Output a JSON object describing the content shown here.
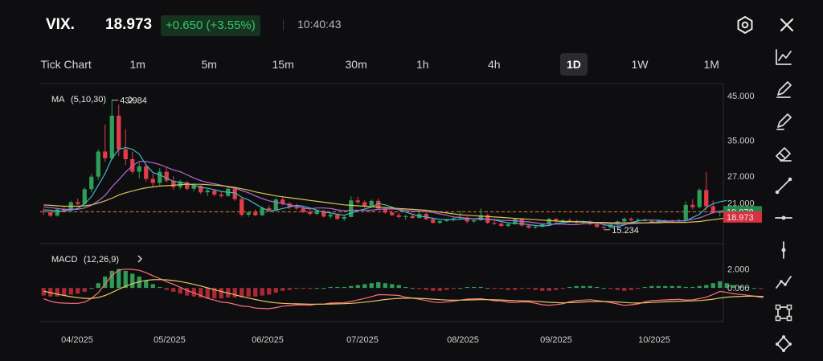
{
  "header": {
    "symbol": "VIX.",
    "price": "18.973",
    "change": "+0.650 (+3.55%)",
    "time": "10:40:43"
  },
  "timeframes": [
    "Tick Chart",
    "1m",
    "5m",
    "15m",
    "30m",
    "1h",
    "4h",
    "1D",
    "1W",
    "1M"
  ],
  "active_timeframe": "1D",
  "toolbar_icons": [
    "chart-type-icon",
    "pencil-icon",
    "brush-icon",
    "eraser-icon",
    "trend-line-icon",
    "horizontal-line-icon",
    "vertical-line-icon",
    "polyline-icon",
    "rectangle-icon",
    "pattern-icon"
  ],
  "colors": {
    "up": "#2f9c58",
    "down": "#e23c49",
    "ma5": "#3fb7c4",
    "ma10": "#b46bd6",
    "ma30": "#d8c553",
    "dif": "#ff6f7e",
    "dea": "#e6c560",
    "background": "#0e0e10"
  },
  "chart_data": [
    {
      "type": "candlestick",
      "title": "",
      "indicator_label": "MA",
      "indicator_params": "(5,10,30)",
      "x_labels": [
        "04/2025",
        "05/2025",
        "06/2025",
        "07/2025",
        "08/2025",
        "09/2025",
        "10/2025"
      ],
      "y_ticks": [
        "45.000",
        "35.000",
        "27.000",
        "21.000"
      ],
      "ylim": [
        12.5,
        45.5
      ],
      "max_annotation": "43.984",
      "min_annotation": "15.234",
      "max_value": 43.984,
      "min_value": 15.234,
      "prev_close_tag": "19.078",
      "last_price_tag": "18.973",
      "prev_close": 19.078,
      "last_price": 18.973,
      "ohlc": [
        [
          19.2,
          19.8,
          18.4,
          19.0
        ],
        [
          19.0,
          19.5,
          17.9,
          18.2
        ],
        [
          18.2,
          19.9,
          18.0,
          19.6
        ],
        [
          19.6,
          20.4,
          19.0,
          19.3
        ],
        [
          19.3,
          21.5,
          19.1,
          21.2
        ],
        [
          21.2,
          22.0,
          20.5,
          20.8
        ],
        [
          20.8,
          24.5,
          20.5,
          24.1
        ],
        [
          24.1,
          27.5,
          23.4,
          26.9
        ],
        [
          26.9,
          33.0,
          26.2,
          32.5
        ],
        [
          32.5,
          38.5,
          30.2,
          31.0
        ],
        [
          31.0,
          43.984,
          30.6,
          40.5
        ],
        [
          40.5,
          43.0,
          31.5,
          33.0
        ],
        [
          33.0,
          37.5,
          29.5,
          30.8
        ],
        [
          30.8,
          32.5,
          27.5,
          28.0
        ],
        [
          28.0,
          30.0,
          26.5,
          29.2
        ],
        [
          29.2,
          29.5,
          25.8,
          26.4
        ],
        [
          26.4,
          27.5,
          24.5,
          25.5
        ],
        [
          25.5,
          28.8,
          25.0,
          28.0
        ],
        [
          28.0,
          29.0,
          25.5,
          26.0
        ],
        [
          26.0,
          27.0,
          24.0,
          24.6
        ],
        [
          24.6,
          26.2,
          24.1,
          25.6
        ],
        [
          25.6,
          25.9,
          23.8,
          24.2
        ],
        [
          24.2,
          25.4,
          23.6,
          24.9
        ],
        [
          24.9,
          25.0,
          23.0,
          23.4
        ],
        [
          23.4,
          24.2,
          22.6,
          23.8
        ],
        [
          23.8,
          24.0,
          22.5,
          22.9
        ],
        [
          22.9,
          23.5,
          22.2,
          22.6
        ],
        [
          22.6,
          24.6,
          22.4,
          24.2
        ],
        [
          24.2,
          24.5,
          21.5,
          21.9
        ],
        [
          21.9,
          22.2,
          18.0,
          18.4
        ],
        [
          18.4,
          19.2,
          17.9,
          18.9
        ],
        [
          18.9,
          19.6,
          18.1,
          18.3
        ],
        [
          18.3,
          20.2,
          18.1,
          19.9
        ],
        [
          19.9,
          20.5,
          19.3,
          19.5
        ],
        [
          19.5,
          22.2,
          19.4,
          21.8
        ],
        [
          21.8,
          22.5,
          20.5,
          20.9
        ],
        [
          20.9,
          21.2,
          19.6,
          20.1
        ],
        [
          20.1,
          20.8,
          19.5,
          19.8
        ],
        [
          19.8,
          20.2,
          18.8,
          19.0
        ],
        [
          19.0,
          19.5,
          18.2,
          18.6
        ],
        [
          18.6,
          19.6,
          18.3,
          19.3
        ],
        [
          19.3,
          19.5,
          17.8,
          18.0
        ],
        [
          18.0,
          18.7,
          17.5,
          18.4
        ],
        [
          18.4,
          18.6,
          17.2,
          17.5
        ],
        [
          17.5,
          18.2,
          17.0,
          17.9
        ],
        [
          17.9,
          22.5,
          17.8,
          21.6
        ],
        [
          21.6,
          22.4,
          20.8,
          21.2
        ],
        [
          21.2,
          21.6,
          20.0,
          20.4
        ],
        [
          20.4,
          21.8,
          20.1,
          21.5
        ],
        [
          21.5,
          22.0,
          19.5,
          19.8
        ],
        [
          19.8,
          20.2,
          18.6,
          18.9
        ],
        [
          18.9,
          19.4,
          18.1,
          18.3
        ],
        [
          18.3,
          18.8,
          17.6,
          17.9
        ],
        [
          17.9,
          18.4,
          17.3,
          18.1
        ],
        [
          18.1,
          18.6,
          17.5,
          17.7
        ],
        [
          17.7,
          18.9,
          17.5,
          18.6
        ],
        [
          18.6,
          18.9,
          17.2,
          17.4
        ],
        [
          17.4,
          17.8,
          16.4,
          16.6
        ],
        [
          16.6,
          17.2,
          16.3,
          17.0
        ],
        [
          17.0,
          17.5,
          16.8,
          17.3
        ],
        [
          17.3,
          17.8,
          16.9,
          17.6
        ],
        [
          17.6,
          19.3,
          17.5,
          17.8
        ],
        [
          17.8,
          18.0,
          16.5,
          16.9
        ],
        [
          16.9,
          17.4,
          16.6,
          17.2
        ],
        [
          17.2,
          19.8,
          17.0,
          18.3
        ],
        [
          18.3,
          18.6,
          16.3,
          16.6
        ],
        [
          16.6,
          17.0,
          16.1,
          16.4
        ],
        [
          16.4,
          16.8,
          15.7,
          15.9
        ],
        [
          15.9,
          16.5,
          15.6,
          16.3
        ],
        [
          16.3,
          17.6,
          16.2,
          17.4
        ],
        [
          17.4,
          17.6,
          15.8,
          16.0
        ],
        [
          16.0,
          16.3,
          15.3,
          15.5
        ],
        [
          15.5,
          16.0,
          15.3,
          15.7
        ],
        [
          15.7,
          16.4,
          15.6,
          16.3
        ],
        [
          16.3,
          17.7,
          16.1,
          17.5
        ],
        [
          17.5,
          17.6,
          16.6,
          16.9
        ],
        [
          16.9,
          17.3,
          16.5,
          17.2
        ],
        [
          17.2,
          17.6,
          16.8,
          17.0
        ],
        [
          17.0,
          17.3,
          16.4,
          16.6
        ],
        [
          16.6,
          17.1,
          16.3,
          16.9
        ],
        [
          16.9,
          17.2,
          16.1,
          16.3
        ],
        [
          16.3,
          16.8,
          15.5,
          15.7
        ],
        [
          15.7,
          16.1,
          15.234,
          15.5
        ],
        [
          15.5,
          16.4,
          15.4,
          16.2
        ],
        [
          16.2,
          17.1,
          15.9,
          16.9
        ],
        [
          16.9,
          17.8,
          16.7,
          17.5
        ],
        [
          17.5,
          17.8,
          16.9,
          17.2
        ],
        [
          17.2,
          17.7,
          16.8,
          17.3
        ],
        [
          17.3,
          17.6,
          16.9,
          17.0
        ],
        [
          17.0,
          17.4,
          16.6,
          16.8
        ],
        [
          16.8,
          17.3,
          16.6,
          17.1
        ],
        [
          17.1,
          17.4,
          16.8,
          17.0
        ],
        [
          17.0,
          17.3,
          16.7,
          16.9
        ],
        [
          16.9,
          17.5,
          16.8,
          17.2
        ],
        [
          17.2,
          21.4,
          17.0,
          20.6
        ],
        [
          20.6,
          21.9,
          19.6,
          20.1
        ],
        [
          20.1,
          24.3,
          19.8,
          23.9
        ],
        [
          23.9,
          28.0,
          19.4,
          20.3
        ],
        [
          20.3,
          21.6,
          18.6,
          18.9
        ],
        [
          18.9,
          19.2,
          18.0,
          18.973
        ]
      ],
      "series": [
        {
          "name": "MA5",
          "color": "#3fb7c4",
          "values": [
            19.5,
            19.4,
            19.2,
            19.2,
            19.5,
            19.8,
            20.9,
            22.4,
            25.0,
            27.6,
            31.0,
            33.0,
            33.4,
            33.0,
            31.9,
            29.5,
            27.8,
            27.3,
            26.6,
            25.8,
            25.7,
            25.3,
            25.0,
            24.5,
            24.3,
            24.0,
            23.6,
            23.4,
            23.3,
            22.3,
            21.7,
            20.8,
            19.9,
            19.3,
            19.4,
            19.8,
            20.1,
            20.5,
            20.3,
            19.9,
            19.4,
            19.0,
            18.8,
            18.5,
            18.3,
            18.8,
            19.3,
            19.7,
            20.1,
            20.9,
            20.6,
            20.1,
            19.5,
            19.0,
            18.5,
            18.1,
            17.9,
            17.6,
            17.4,
            17.3,
            17.3,
            17.4,
            17.5,
            17.5,
            17.6,
            17.4,
            17.2,
            16.9,
            16.6,
            16.5,
            16.4,
            16.2,
            16.0,
            15.9,
            16.0,
            16.5,
            16.6,
            16.8,
            16.9,
            16.9,
            16.8,
            16.6,
            16.2,
            15.9,
            15.8,
            16.1,
            16.7,
            17.0,
            17.2,
            17.2,
            17.2,
            17.0,
            17.0,
            17.0,
            17.0,
            17.8,
            18.5,
            20.0,
            20.9,
            21.3,
            21.6
          ]
        },
        {
          "name": "MA10",
          "color": "#b46bd6",
          "values": [
            20.2,
            20.0,
            19.8,
            19.6,
            19.6,
            19.6,
            19.9,
            20.5,
            21.5,
            22.7,
            24.6,
            26.2,
            27.9,
            29.3,
            30.3,
            30.3,
            30.0,
            29.6,
            29.0,
            28.4,
            28.0,
            27.3,
            26.6,
            26.0,
            25.6,
            25.3,
            25.0,
            24.6,
            24.3,
            23.8,
            23.3,
            22.6,
            22.0,
            21.5,
            21.2,
            20.9,
            20.6,
            20.3,
            19.9,
            19.7,
            19.9,
            19.9,
            19.8,
            19.5,
            19.3,
            19.4,
            19.4,
            19.4,
            19.4,
            19.6,
            19.7,
            19.7,
            19.6,
            19.4,
            19.2,
            19.2,
            19.1,
            18.9,
            18.6,
            18.3,
            17.9,
            17.8,
            17.6,
            17.5,
            17.4,
            17.4,
            17.3,
            17.2,
            17.1,
            17.1,
            16.9,
            16.8,
            16.6,
            16.4,
            16.3,
            16.3,
            16.3,
            16.2,
            16.2,
            16.4,
            16.5,
            16.5,
            16.5,
            16.4,
            16.3,
            16.3,
            16.4,
            16.5,
            16.6,
            16.7,
            16.8,
            16.9,
            17.0,
            17.0,
            17.1,
            17.4,
            17.7,
            18.3,
            18.9,
            19.2,
            19.3
          ]
        },
        {
          "name": "MA30",
          "color": "#d8c553",
          "values": [
            20.6,
            20.5,
            20.4,
            20.3,
            20.3,
            20.3,
            20.4,
            20.6,
            21.0,
            21.5,
            22.1,
            22.8,
            23.3,
            23.7,
            24.1,
            24.4,
            24.6,
            24.8,
            24.9,
            25.0,
            25.1,
            25.2,
            25.2,
            25.2,
            25.1,
            25.0,
            24.9,
            24.7,
            24.5,
            24.2,
            23.9,
            23.5,
            23.2,
            22.9,
            22.6,
            22.4,
            22.2,
            22.0,
            21.8,
            21.6,
            21.4,
            21.2,
            21.0,
            20.8,
            20.6,
            20.5,
            20.4,
            20.3,
            20.2,
            20.1,
            20.0,
            19.9,
            19.8,
            19.7,
            19.6,
            19.5,
            19.4,
            19.2,
            19.0,
            18.8,
            18.6,
            18.4,
            18.3,
            18.2,
            18.1,
            18.0,
            17.9,
            17.8,
            17.7,
            17.6,
            17.5,
            17.4,
            17.3,
            17.2,
            17.1,
            17.0,
            16.9,
            16.9,
            16.8,
            16.8,
            16.7,
            16.7,
            16.7,
            16.6,
            16.6,
            16.6,
            16.6,
            16.6,
            16.6,
            16.6,
            16.6,
            16.7,
            16.7,
            16.7,
            16.7,
            16.8,
            16.9,
            17.1,
            17.3,
            17.5,
            17.7
          ]
        }
      ]
    },
    {
      "type": "macd",
      "title": "",
      "indicator_label": "MACD",
      "indicator_params": "(12,26,9)",
      "y_ticks": [
        "2.000",
        "0.000"
      ],
      "ylim": [
        -3.2,
        3.9
      ],
      "histogram": [
        -0.8,
        -0.9,
        -0.9,
        -0.8,
        -0.7,
        -0.6,
        -0.4,
        0.0,
        0.5,
        1.2,
        1.8,
        2.0,
        1.8,
        1.5,
        1.2,
        0.8,
        0.4,
        0.1,
        -0.2,
        -0.4,
        -0.6,
        -0.8,
        -0.9,
        -1.0,
        -1.1,
        -1.1,
        -1.1,
        -1.0,
        -1.0,
        -1.0,
        -0.9,
        -0.9,
        -0.8,
        -0.7,
        -0.5,
        -0.3,
        -0.2,
        -0.1,
        -0.1,
        -0.1,
        0.0,
        0.0,
        0.1,
        0.1,
        0.1,
        0.2,
        0.3,
        0.4,
        0.5,
        0.6,
        0.5,
        0.4,
        0.3,
        0.1,
        0.0,
        -0.1,
        -0.2,
        -0.3,
        -0.3,
        -0.2,
        -0.1,
        0.0,
        0.1,
        0.1,
        0.1,
        0.0,
        -0.1,
        -0.1,
        -0.2,
        -0.2,
        -0.1,
        -0.1,
        -0.2,
        -0.3,
        -0.3,
        -0.2,
        -0.1,
        0.1,
        0.2,
        0.2,
        0.2,
        0.1,
        0.0,
        -0.1,
        -0.2,
        -0.3,
        -0.2,
        -0.1,
        0.1,
        0.2,
        0.2,
        0.2,
        0.2,
        0.2,
        0.1,
        0.1,
        0.2,
        0.3,
        0.5,
        0.7,
        0.5,
        0.3,
        0.2,
        0.1,
        0.0,
        -0.1,
        -0.1
      ]
    }
  ]
}
